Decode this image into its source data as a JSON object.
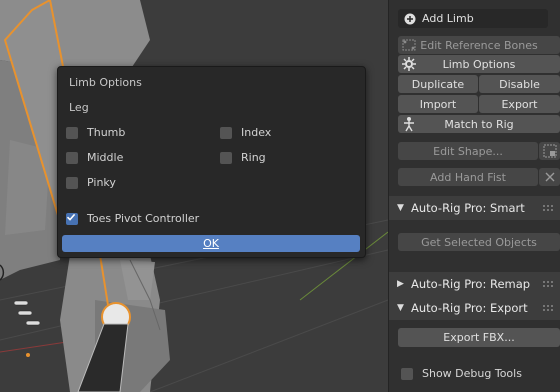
{
  "dialog": {
    "title": "Limb Options",
    "limb_type": "Leg",
    "options": [
      {
        "label": "Thumb",
        "checked": false
      },
      {
        "label": "Index",
        "checked": false
      },
      {
        "label": "Middle",
        "checked": false
      },
      {
        "label": "Ring",
        "checked": false
      },
      {
        "label": "Pinky",
        "checked": false
      },
      {
        "label": "Toes Pivot Controller",
        "checked": true
      }
    ],
    "ok_label": "OK"
  },
  "sidebar": {
    "add_limb_label": "Add Limb",
    "edit_reference_bones_label": "Edit Reference Bones",
    "limb_options_label": "Limb Options",
    "duplicate_label": "Duplicate",
    "disable_label": "Disable",
    "import_label": "Import",
    "export_label": "Export",
    "match_to_rig_label": "Match to Rig",
    "edit_shape_label": "Edit Shape...",
    "add_hand_fist_label": "Add Hand Fist",
    "smart_panel_title": "Auto-Rig Pro: Smart",
    "get_selected_objects_label": "Get Selected Objects",
    "remap_panel_title": "Auto-Rig Pro: Remap",
    "export_panel_title": "Auto-Rig Pro: Export",
    "export_fbx_label": "Export FBX...",
    "show_debug_tools_label": "Show Debug Tools",
    "show_debug_tools_checked": false
  },
  "colors": {
    "accent_blue": "#4772b3",
    "ok_button": "#5680c2",
    "bone_orange": "#e8922e",
    "panel_bg": "#303030"
  }
}
